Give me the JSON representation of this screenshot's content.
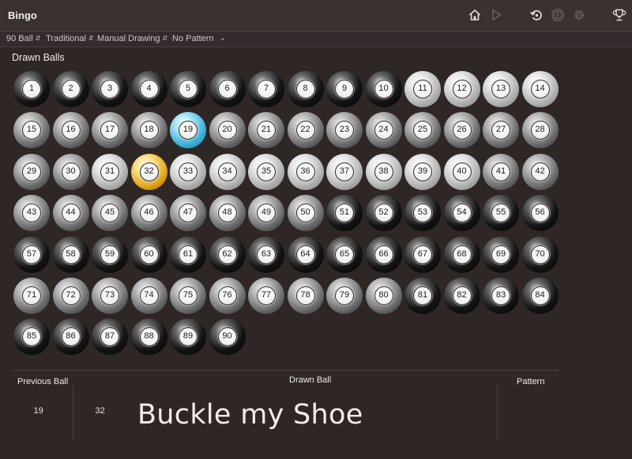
{
  "app": {
    "title": "Bingo"
  },
  "toolbar": {
    "ball_count": "90 Ball",
    "game_style": "Traditional",
    "drawing_mode": "Manual Drawing",
    "pattern": "No Pattern"
  },
  "titlebar_icons": [
    "home-icon",
    "play-icon",
    "undo-icon",
    "coin-icon",
    "gear-icon",
    "trophy-icon"
  ],
  "drawn_section": {
    "title": "Drawn Balls"
  },
  "balls": [
    {
      "n": "1",
      "s": "dark"
    },
    {
      "n": "2",
      "s": "dark"
    },
    {
      "n": "3",
      "s": "dark"
    },
    {
      "n": "4",
      "s": "dark"
    },
    {
      "n": "5",
      "s": "dark"
    },
    {
      "n": "6",
      "s": "dark"
    },
    {
      "n": "7",
      "s": "dark"
    },
    {
      "n": "8",
      "s": "dark"
    },
    {
      "n": "9",
      "s": "dark"
    },
    {
      "n": "10",
      "s": "dark"
    },
    {
      "n": "11",
      "s": "light"
    },
    {
      "n": "12",
      "s": "light"
    },
    {
      "n": "13",
      "s": "light"
    },
    {
      "n": "14",
      "s": "light"
    },
    {
      "n": "15",
      "s": "mid"
    },
    {
      "n": "16",
      "s": "mid"
    },
    {
      "n": "17",
      "s": "mid"
    },
    {
      "n": "18",
      "s": "mid"
    },
    {
      "n": "19",
      "s": "blue"
    },
    {
      "n": "20",
      "s": "mid"
    },
    {
      "n": "21",
      "s": "mid"
    },
    {
      "n": "22",
      "s": "mid"
    },
    {
      "n": "23",
      "s": "mid"
    },
    {
      "n": "24",
      "s": "mid"
    },
    {
      "n": "25",
      "s": "mid"
    },
    {
      "n": "26",
      "s": "mid"
    },
    {
      "n": "27",
      "s": "mid"
    },
    {
      "n": "28",
      "s": "mid"
    },
    {
      "n": "29",
      "s": "mid"
    },
    {
      "n": "30",
      "s": "mid"
    },
    {
      "n": "31",
      "s": "light"
    },
    {
      "n": "32",
      "s": "gold"
    },
    {
      "n": "33",
      "s": "light"
    },
    {
      "n": "34",
      "s": "light"
    },
    {
      "n": "35",
      "s": "light"
    },
    {
      "n": "36",
      "s": "light"
    },
    {
      "n": "37",
      "s": "light"
    },
    {
      "n": "38",
      "s": "light"
    },
    {
      "n": "39",
      "s": "light"
    },
    {
      "n": "40",
      "s": "light"
    },
    {
      "n": "41",
      "s": "mid"
    },
    {
      "n": "42",
      "s": "mid"
    },
    {
      "n": "43",
      "s": "mid"
    },
    {
      "n": "44",
      "s": "mid"
    },
    {
      "n": "45",
      "s": "mid"
    },
    {
      "n": "46",
      "s": "mid"
    },
    {
      "n": "47",
      "s": "mid"
    },
    {
      "n": "48",
      "s": "mid"
    },
    {
      "n": "49",
      "s": "mid"
    },
    {
      "n": "50",
      "s": "mid"
    },
    {
      "n": "51",
      "s": "dark"
    },
    {
      "n": "52",
      "s": "dark"
    },
    {
      "n": "53",
      "s": "dark"
    },
    {
      "n": "54",
      "s": "dark"
    },
    {
      "n": "55",
      "s": "dark"
    },
    {
      "n": "56",
      "s": "dark"
    },
    {
      "n": "57",
      "s": "dark"
    },
    {
      "n": "58",
      "s": "dark"
    },
    {
      "n": "59",
      "s": "dark"
    },
    {
      "n": "60",
      "s": "dark"
    },
    {
      "n": "61",
      "s": "dark"
    },
    {
      "n": "62",
      "s": "dark"
    },
    {
      "n": "63",
      "s": "dark"
    },
    {
      "n": "64",
      "s": "dark"
    },
    {
      "n": "65",
      "s": "dark"
    },
    {
      "n": "66",
      "s": "dark"
    },
    {
      "n": "67",
      "s": "dark"
    },
    {
      "n": "68",
      "s": "dark"
    },
    {
      "n": "69",
      "s": "dark"
    },
    {
      "n": "70",
      "s": "dark"
    },
    {
      "n": "71",
      "s": "mid"
    },
    {
      "n": "72",
      "s": "mid"
    },
    {
      "n": "73",
      "s": "mid"
    },
    {
      "n": "74",
      "s": "mid"
    },
    {
      "n": "75",
      "s": "mid"
    },
    {
      "n": "76",
      "s": "mid"
    },
    {
      "n": "77",
      "s": "mid"
    },
    {
      "n": "78",
      "s": "mid"
    },
    {
      "n": "79",
      "s": "mid"
    },
    {
      "n": "80",
      "s": "mid"
    },
    {
      "n": "81",
      "s": "dark"
    },
    {
      "n": "82",
      "s": "dark"
    },
    {
      "n": "83",
      "s": "dark"
    },
    {
      "n": "84",
      "s": "dark"
    },
    {
      "n": "85",
      "s": "dark"
    },
    {
      "n": "86",
      "s": "dark"
    },
    {
      "n": "87",
      "s": "dark"
    },
    {
      "n": "88",
      "s": "dark"
    },
    {
      "n": "89",
      "s": "dark"
    },
    {
      "n": "90",
      "s": "dark"
    }
  ],
  "bottom": {
    "previous_label": "Previous Ball",
    "previous_number": "19",
    "drawn_label": "Drawn Ball",
    "drawn_number": "32",
    "drawn_call": "Buckle my Shoe",
    "pattern_label": "Pattern"
  },
  "colors": {
    "background": "#2f2626",
    "titlebar": "#3a3131",
    "accent_blue": "#3fb2d8",
    "accent_gold": "#e3a821"
  }
}
